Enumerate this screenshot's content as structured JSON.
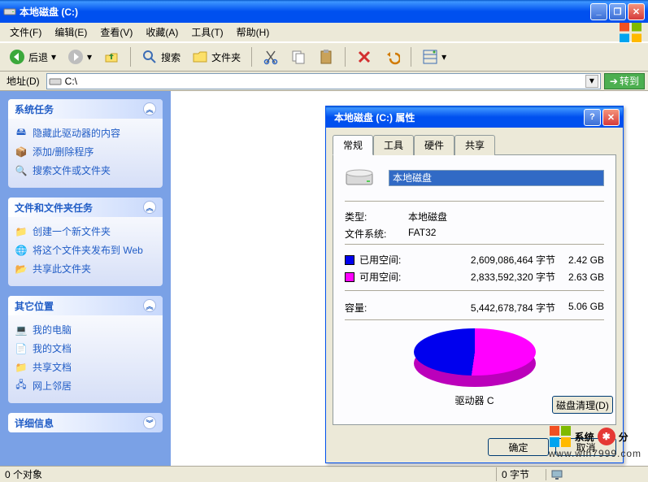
{
  "window": {
    "title": "本地磁盘  (C:)"
  },
  "menu": {
    "file": "文件(F)",
    "edit": "编辑(E)",
    "view": "查看(V)",
    "favorites": "收藏(A)",
    "tools": "工具(T)",
    "help": "帮助(H)"
  },
  "toolbar": {
    "back": "后退",
    "search": "搜索",
    "folders": "文件夹"
  },
  "address": {
    "label": "地址(D)",
    "value": "C:\\",
    "go": "转到"
  },
  "sidebar": {
    "panels": [
      {
        "title": "系统任务",
        "items": [
          {
            "icon": "drive",
            "label": "隐藏此驱动器的内容"
          },
          {
            "icon": "addremove",
            "label": "添加/删除程序"
          },
          {
            "icon": "search",
            "label": "搜索文件或文件夹"
          }
        ]
      },
      {
        "title": "文件和文件夹任务",
        "items": [
          {
            "icon": "newfolder",
            "label": "创建一个新文件夹"
          },
          {
            "icon": "publish",
            "label": "将这个文件夹发布到 Web"
          },
          {
            "icon": "share",
            "label": "共享此文件夹"
          }
        ]
      },
      {
        "title": "其它位置",
        "items": [
          {
            "icon": "computer",
            "label": "我的电脑"
          },
          {
            "icon": "documents",
            "label": "我的文档"
          },
          {
            "icon": "sharedocs",
            "label": "共享文档"
          },
          {
            "icon": "network",
            "label": "网上邻居"
          }
        ]
      },
      {
        "title": "详细信息",
        "collapsed": true
      }
    ]
  },
  "dialog": {
    "title": "本地磁盘 (C:) 属性",
    "tabs": {
      "general": "常规",
      "tools": "工具",
      "hardware": "硬件",
      "sharing": "共享"
    },
    "name_value": "本地磁盘",
    "type_label": "类型:",
    "type_value": "本地磁盘",
    "fs_label": "文件系统:",
    "fs_value": "FAT32",
    "used_label": "已用空间:",
    "used_bytes": "2,609,086,464 字节",
    "used_h": "2.42 GB",
    "free_label": "可用空间:",
    "free_bytes": "2,833,592,320 字节",
    "free_h": "2.63 GB",
    "cap_label": "容量:",
    "cap_bytes": "5,442,678,784 字节",
    "cap_h": "5.06 GB",
    "drive_label": "驱动器 C",
    "cleanup": "磁盘清理(D)",
    "ok": "确定",
    "cancel": "取消"
  },
  "status": {
    "objects": "0 个对象",
    "bytes": "0 字节"
  },
  "watermark": {
    "brand": "系统",
    "brand2": "分",
    "url": "www.win7999.com"
  },
  "chart_data": {
    "type": "pie",
    "title": "驱动器 C",
    "series": [
      {
        "name": "已用空间",
        "value": 2609086464,
        "human": "2.42 GB",
        "color": "#0000ee"
      },
      {
        "name": "可用空间",
        "value": 2833592320,
        "human": "2.63 GB",
        "color": "#ff00ff"
      }
    ],
    "total": {
      "label": "容量",
      "value": 5442678784,
      "human": "5.06 GB"
    }
  }
}
